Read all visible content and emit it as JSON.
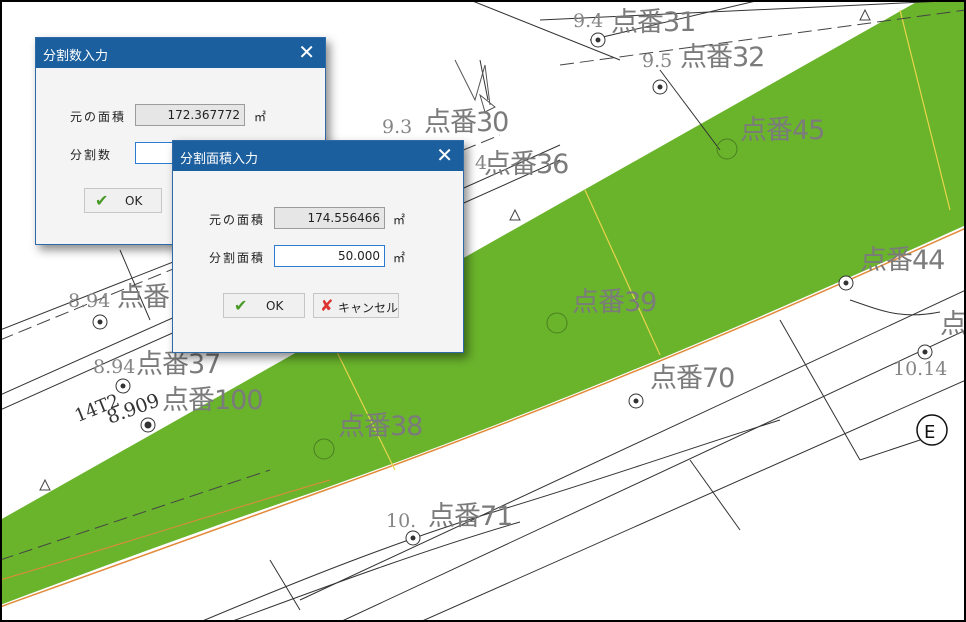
{
  "map": {
    "point_labels": [
      "点番31",
      "点番32",
      "点番30",
      "点番36",
      "点番45",
      "点番44",
      "点番39",
      "点番37",
      "点番100",
      "点番70",
      "点番38",
      "点番71",
      "点"
    ],
    "elevation_labels": [
      "9.4",
      "9.5",
      "9.3",
      "8.94",
      "8.94",
      "8.909",
      "10.",
      "10.14",
      "4"
    ],
    "code_label": "14T2",
    "colors": {
      "parcel_fill": "#6ab42c",
      "line": "#333333",
      "text": "#7b7b7b"
    }
  },
  "dialog_division_count": {
    "title": "分割数入力",
    "close_label": "✕",
    "original_area_label": "元の面積",
    "original_area_value": "172.367772",
    "unit": "㎡",
    "division_count_label": "分割数",
    "division_count_value": "",
    "ok_label": "OK"
  },
  "dialog_division_area": {
    "title": "分割面積入力",
    "close_label": "✕",
    "original_area_label": "元の面積",
    "original_area_value": "174.556466",
    "unit": "㎡",
    "division_area_label": "分割面積",
    "division_area_value": "50.000",
    "ok_label": "OK",
    "cancel_label": "キャンセル"
  }
}
